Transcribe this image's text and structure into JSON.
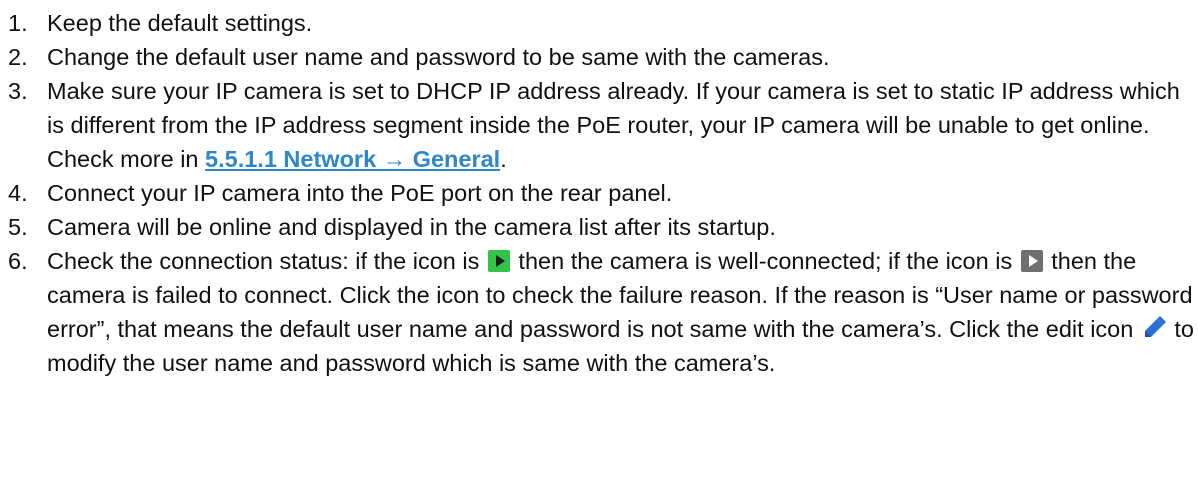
{
  "steps": [
    {
      "number": "1.",
      "text": "Keep the default settings."
    },
    {
      "number": "2.",
      "text": "Change the default user name and password to be same with the cameras."
    },
    {
      "number": "3.",
      "text_before_link": "Make sure your IP camera is set to DHCP IP address already. If your camera is set to static IP address which is different from the IP address segment inside the PoE router, your IP camera will be unable to get online. Check more in ",
      "link_text": "5.5.1.1 Network → General",
      "text_after_link": "."
    },
    {
      "number": "4.",
      "text": "Connect your IP camera into the PoE port on the rear panel."
    },
    {
      "number": "5.",
      "text": "Camera will be online and displayed in the camera list after its startup."
    },
    {
      "number": "6.",
      "part1": " Check the connection status: if the icon is ",
      "part2": " then the camera is well-connected; if the icon is ",
      "part3": " then the camera is failed to connect. Click the icon to check the failure reason. If the reason is “User name or password error”, that means the default user name and password is not same with the camera’s. Click the edit icon ",
      "part4": " to modify the user name and password which is same with the camera’s."
    }
  ],
  "icons": {
    "connected": "play-icon-green",
    "failed": "play-icon-gray",
    "edit": "pencil-icon"
  },
  "colors": {
    "link": "#2f86c9",
    "connected_icon": "#33c24a",
    "failed_icon": "#6f6f6f",
    "edit_icon": "#2b6fd6"
  }
}
